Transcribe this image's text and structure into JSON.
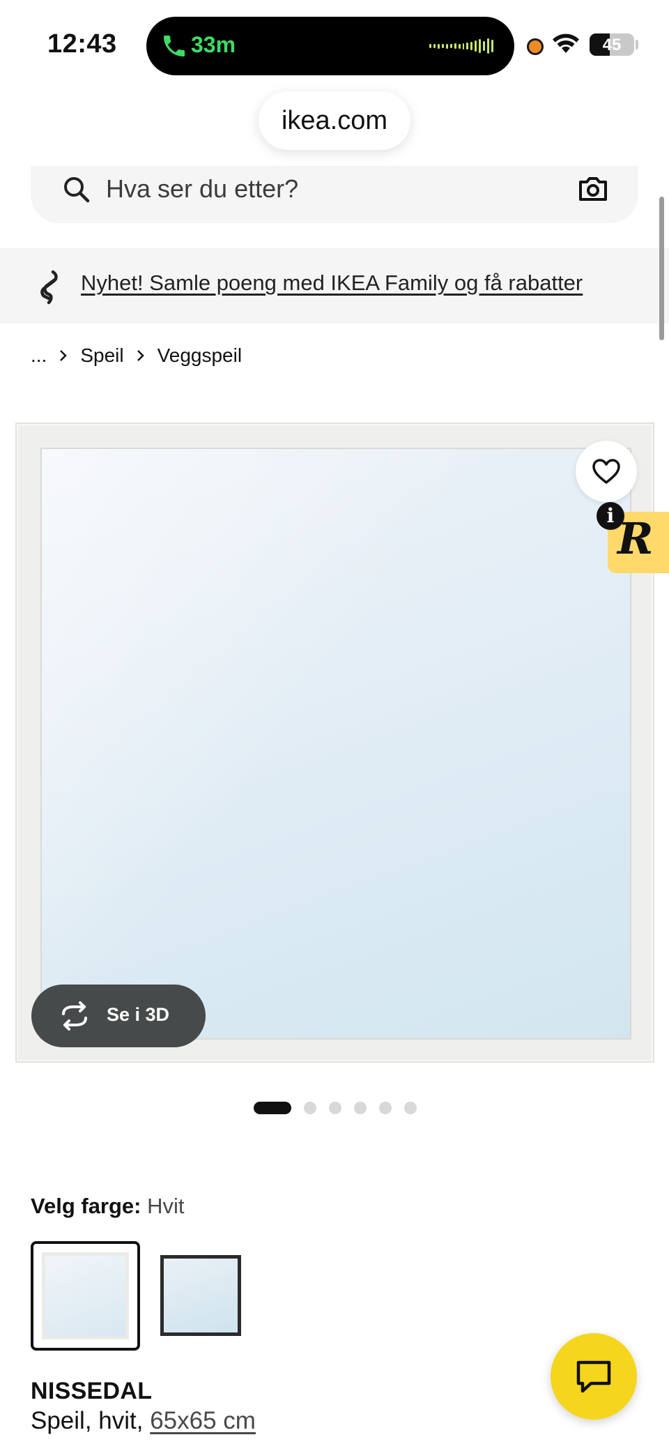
{
  "status_bar": {
    "time": "12:43",
    "call_duration": "33m",
    "battery_level": "45",
    "battery_fraction": 0.45
  },
  "browser": {
    "url": "ikea.com"
  },
  "search": {
    "placeholder": "Hva ser du etter?"
  },
  "promo": {
    "text": "Nyhet! Samle poeng med IKEA Family og få rabatter"
  },
  "breadcrumb": {
    "items": [
      "...",
      "Speil",
      "Veggspeil"
    ]
  },
  "gallery": {
    "view_3d_label": "Se i 3D",
    "extension_badge": "R",
    "info_badge": "i",
    "page_count": 6,
    "active_page": 1
  },
  "color_picker": {
    "label": "Velg farge:",
    "selected": "Hvit",
    "options": [
      "white",
      "black"
    ]
  },
  "product": {
    "name": "NISSEDAL",
    "desc_prefix": "Speil, hvit, ",
    "size": "65x65 cm"
  },
  "colors": {
    "accent_yellow": "#f6d61c",
    "call_green": "#3ddc64",
    "button_dark": "#474a4a"
  },
  "icons": {
    "search": "search-icon",
    "camera": "camera-icon",
    "heart": "heart-icon",
    "rotate": "rotate-3d-icon",
    "chat": "chat-icon"
  }
}
